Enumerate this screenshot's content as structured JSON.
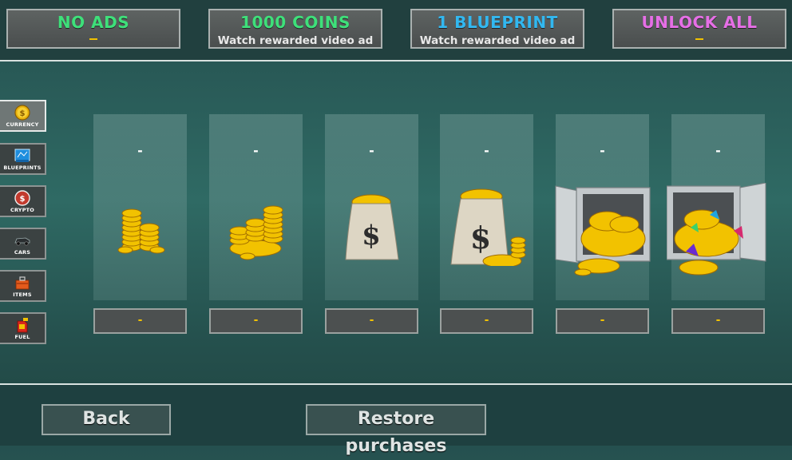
{
  "top_offers": [
    {
      "title": "NO ADS",
      "sub": "",
      "color": "#3ee07a"
    },
    {
      "title": "1000 COINS",
      "sub": "Watch rewarded video ad",
      "color": "#3ee07a"
    },
    {
      "title": "1 BLUEPRINT",
      "sub": "Watch rewarded video ad",
      "color": "#32b8f0"
    },
    {
      "title": "UNLOCK ALL",
      "sub": "",
      "color": "#e66fe6"
    }
  ],
  "offer_price_placeholder": "-",
  "sidebar": {
    "items": [
      {
        "label": "CURRENCY",
        "icon": "coin-icon",
        "active": true
      },
      {
        "label": "BLUEPRINTS",
        "icon": "blueprint-icon",
        "active": false
      },
      {
        "label": "CRYPTO",
        "icon": "crypto-coin-icon",
        "active": false
      },
      {
        "label": "CARS",
        "icon": "car-icon",
        "active": false
      },
      {
        "label": "ITEMS",
        "icon": "toolbox-icon",
        "active": false
      },
      {
        "label": "FUEL",
        "icon": "fuel-can-icon",
        "active": false
      }
    ]
  },
  "products": [
    {
      "amount": "-",
      "price": "-",
      "icon": "small-coin-stack-icon"
    },
    {
      "amount": "-",
      "price": "-",
      "icon": "coin-pile-icon"
    },
    {
      "amount": "-",
      "price": "-",
      "icon": "money-bag-icon"
    },
    {
      "amount": "-",
      "price": "-",
      "icon": "large-money-bag-icon"
    },
    {
      "amount": "-",
      "price": "-",
      "icon": "coin-safe-icon"
    },
    {
      "amount": "-",
      "price": "-",
      "icon": "gem-safe-icon"
    }
  ],
  "footer": {
    "back_label": "Back",
    "restore_label": "Restore purchases"
  }
}
